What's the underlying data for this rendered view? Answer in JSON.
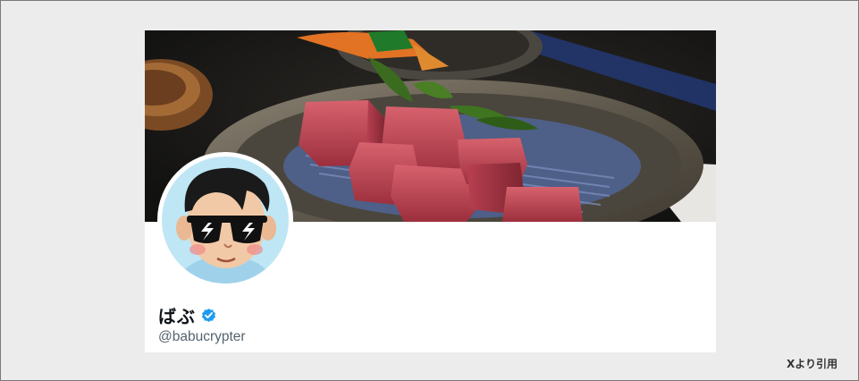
{
  "profile": {
    "display_name": "ばぶ",
    "handle": "@babucrypter",
    "verified": true,
    "verified_icon": "verified-badge-icon",
    "banner_image": "wagyu-beef-plate-photo",
    "avatar_image": "cartoon-man-sunglasses-avatar"
  },
  "footer": {
    "source_note": "Xより引用"
  },
  "colors": {
    "page_bg": "#ececec",
    "card_bg": "#ffffff",
    "name_text": "#0f1419",
    "handle_text": "#536471",
    "verified_blue": "#1d9bf0",
    "border": "#7a7a7a"
  }
}
